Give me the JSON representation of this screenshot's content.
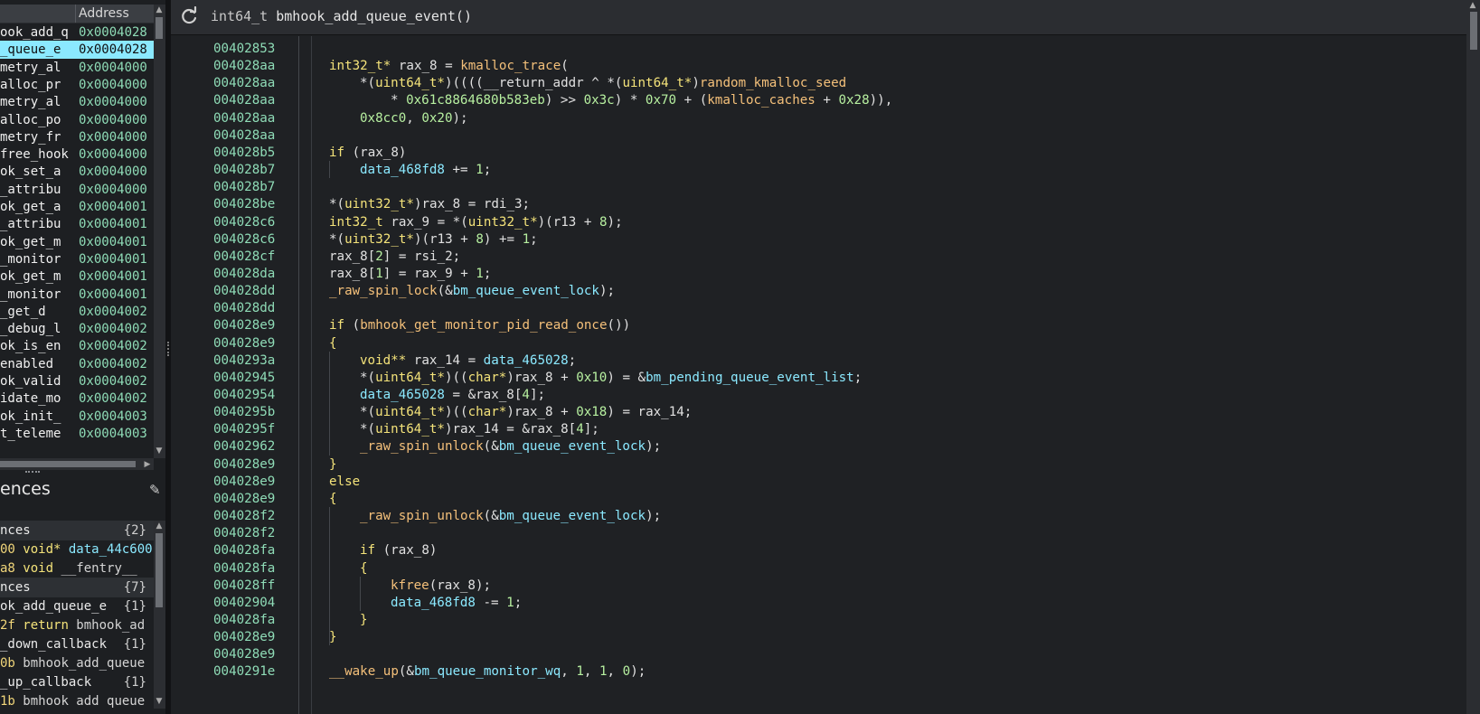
{
  "symbols": {
    "address_header": "Address",
    "rows": [
      {
        "name": "ook_add_q",
        "address": "0x0004028"
      },
      {
        "name": "_queue_e",
        "address": "0x0004028",
        "selected": true
      },
      {
        "name": "metry_al",
        "address": "0x0004000"
      },
      {
        "name": "alloc_pr",
        "address": "0x0004000"
      },
      {
        "name": "metry_al",
        "address": "0x0004000"
      },
      {
        "name": "alloc_po",
        "address": "0x0004000"
      },
      {
        "name": "metry_fr",
        "address": "0x0004000"
      },
      {
        "name": "free_hook",
        "address": "0x0004000"
      },
      {
        "name": "ok_set_a",
        "address": "0x0004000"
      },
      {
        "name": "_attribu",
        "address": "0x0004000"
      },
      {
        "name": "ok_get_a",
        "address": "0x0004001"
      },
      {
        "name": "_attribu",
        "address": "0x0004001"
      },
      {
        "name": "ok_get_m",
        "address": "0x0004001"
      },
      {
        "name": "_monitor",
        "address": "0x0004001"
      },
      {
        "name": "ok_get_m",
        "address": "0x0004001"
      },
      {
        "name": "_monitor",
        "address": "0x0004001"
      },
      {
        "name": "_get_d",
        "address": "0x0004002"
      },
      {
        "name": "_debug_l",
        "address": "0x0004002"
      },
      {
        "name": "ok_is_en",
        "address": "0x0004002"
      },
      {
        "name": "enabled",
        "address": "0x0004002"
      },
      {
        "name": "ok_valid",
        "address": "0x0004002"
      },
      {
        "name": "idate_mo",
        "address": "0x0004002"
      },
      {
        "name": "ok_init_",
        "address": "0x0004003"
      },
      {
        "name": "t_teleme",
        "address": "0x0004003"
      }
    ]
  },
  "references": {
    "title": "ences",
    "rows": [
      {
        "kind": "group",
        "text": "nces",
        "count": "{2}"
      },
      {
        "kind": "item",
        "addr": "00",
        "kw": "void*",
        "rest": " data_44c600"
      },
      {
        "kind": "item",
        "addr": "a8",
        "kw": "void",
        "rest": " __fentry__"
      },
      {
        "kind": "group",
        "text": "nces",
        "count": "{7}"
      },
      {
        "kind": "item",
        "text": "ok_add_queue_e",
        "count": "{1}"
      },
      {
        "kind": "item",
        "addr": "2f",
        "kw": "return",
        "rest": " bmhook_ad"
      },
      {
        "kind": "item",
        "text": "_down_callback",
        "count": "{1}"
      },
      {
        "kind": "item",
        "addr": "0b",
        "kw": "",
        "rest": "bmhook_add_queue"
      },
      {
        "kind": "item",
        "text": "_up_callback",
        "count": "{1}"
      },
      {
        "kind": "item",
        "addr": "1b",
        "kw": "",
        "rest": "bmhook_add_queue"
      }
    ]
  },
  "header": {
    "return_type": "int64_t",
    "function_name": "bmhook_add_queue_event()"
  },
  "code_lines": [
    {
      "addr": "00402853",
      "indent": 0,
      "tokens": []
    },
    {
      "addr": "004028aa",
      "indent": 1,
      "tokens": [
        [
          "type",
          "int32_t*"
        ],
        [
          "txt",
          " rax_8 = "
        ],
        [
          "fn",
          "kmalloc_trace"
        ],
        [
          "txt",
          "("
        ]
      ]
    },
    {
      "addr": "004028aa",
      "indent": 2,
      "tokens": [
        [
          "txt",
          "*("
        ],
        [
          "type",
          "uint64_t*"
        ],
        [
          "txt",
          ")(((("
        ],
        [
          "txt",
          "__return_addr ^ *("
        ],
        [
          "type",
          "uint64_t*"
        ],
        [
          "txt",
          ")"
        ],
        [
          "fn",
          "random_kmalloc_seed"
        ],
        [
          "txt",
          ""
        ]
      ]
    },
    {
      "addr": "004028aa",
      "indent": 3,
      "tokens": [
        [
          "txt",
          "* "
        ],
        [
          "num",
          "0x61c8864680b583eb"
        ],
        [
          "txt",
          ") >> "
        ],
        [
          "num",
          "0x3c"
        ],
        [
          "txt",
          ") * "
        ],
        [
          "num",
          "0x70"
        ],
        [
          "txt",
          " + ("
        ],
        [
          "fn",
          "kmalloc_caches"
        ],
        [
          "txt",
          " + "
        ],
        [
          "num",
          "0x28"
        ],
        [
          "txt",
          ")),"
        ]
      ]
    },
    {
      "addr": "004028aa",
      "indent": 2,
      "tokens": [
        [
          "num",
          "0x8cc0"
        ],
        [
          "txt",
          ", "
        ],
        [
          "num",
          "0x20"
        ],
        [
          "txt",
          ");"
        ]
      ]
    },
    {
      "addr": "004028aa",
      "indent": 0,
      "tokens": []
    },
    {
      "addr": "004028b5",
      "indent": 1,
      "tokens": [
        [
          "type",
          "if"
        ],
        [
          "txt",
          " (rax_8)"
        ]
      ]
    },
    {
      "addr": "004028b7",
      "indent": 2,
      "tokens": [
        [
          "data",
          "data_468fd8"
        ],
        [
          "txt",
          " += "
        ],
        [
          "num",
          "1"
        ],
        [
          "txt",
          ";"
        ]
      ]
    },
    {
      "addr": "004028b7",
      "indent": 0,
      "tokens": []
    },
    {
      "addr": "004028be",
      "indent": 1,
      "tokens": [
        [
          "txt",
          "*("
        ],
        [
          "type",
          "uint32_t*"
        ],
        [
          "txt",
          ")rax_8 = rdi_3;"
        ]
      ]
    },
    {
      "addr": "004028c6",
      "indent": 1,
      "tokens": [
        [
          "type",
          "int32_t"
        ],
        [
          "txt",
          " rax_9 = *("
        ],
        [
          "type",
          "uint32_t*"
        ],
        [
          "txt",
          ")(r13 + "
        ],
        [
          "num",
          "8"
        ],
        [
          "txt",
          ");"
        ]
      ]
    },
    {
      "addr": "004028c6",
      "indent": 1,
      "tokens": [
        [
          "txt",
          "*("
        ],
        [
          "type",
          "uint32_t*"
        ],
        [
          "txt",
          ")(r13 + "
        ],
        [
          "num",
          "8"
        ],
        [
          "txt",
          ") += "
        ],
        [
          "num",
          "1"
        ],
        [
          "txt",
          ";"
        ]
      ]
    },
    {
      "addr": "004028cf",
      "indent": 1,
      "tokens": [
        [
          "txt",
          "rax_8["
        ],
        [
          "num",
          "2"
        ],
        [
          "txt",
          "] = rsi_2;"
        ]
      ]
    },
    {
      "addr": "004028da",
      "indent": 1,
      "tokens": [
        [
          "txt",
          "rax_8["
        ],
        [
          "num",
          "1"
        ],
        [
          "txt",
          "] = rax_9 + "
        ],
        [
          "num",
          "1"
        ],
        [
          "txt",
          ";"
        ]
      ]
    },
    {
      "addr": "004028dd",
      "indent": 1,
      "tokens": [
        [
          "fn",
          "_raw_spin_lock"
        ],
        [
          "txt",
          "(&"
        ],
        [
          "data",
          "bm_queue_event_lock"
        ],
        [
          "txt",
          ");"
        ]
      ]
    },
    {
      "addr": "004028dd",
      "indent": 0,
      "tokens": []
    },
    {
      "addr": "004028e9",
      "indent": 1,
      "tokens": [
        [
          "type",
          "if"
        ],
        [
          "txt",
          " ("
        ],
        [
          "fn",
          "bmhook_get_monitor_pid_read_once"
        ],
        [
          "txt",
          "())"
        ]
      ]
    },
    {
      "addr": "004028e9",
      "indent": 1,
      "tokens": [
        [
          "type",
          "{"
        ]
      ]
    },
    {
      "addr": "0040293a",
      "indent": 2,
      "tokens": [
        [
          "type",
          "void**"
        ],
        [
          "txt",
          " rax_14 = "
        ],
        [
          "data",
          "data_465028"
        ],
        [
          "txt",
          ";"
        ]
      ]
    },
    {
      "addr": "00402945",
      "indent": 2,
      "tokens": [
        [
          "txt",
          "*("
        ],
        [
          "type",
          "uint64_t*"
        ],
        [
          "txt",
          ")(("
        ],
        [
          "type",
          "char*"
        ],
        [
          "txt",
          ")rax_8 + "
        ],
        [
          "num",
          "0x10"
        ],
        [
          "txt",
          ") = &"
        ],
        [
          "data",
          "bm_pending_queue_event_list"
        ],
        [
          "txt",
          ";"
        ]
      ]
    },
    {
      "addr": "00402954",
      "indent": 2,
      "tokens": [
        [
          "data",
          "data_465028"
        ],
        [
          "txt",
          " = &rax_8["
        ],
        [
          "num",
          "4"
        ],
        [
          "txt",
          "];"
        ]
      ]
    },
    {
      "addr": "0040295b",
      "indent": 2,
      "tokens": [
        [
          "txt",
          "*("
        ],
        [
          "type",
          "uint64_t*"
        ],
        [
          "txt",
          ")(("
        ],
        [
          "type",
          "char*"
        ],
        [
          "txt",
          ")rax_8 + "
        ],
        [
          "num",
          "0x18"
        ],
        [
          "txt",
          ") = rax_14;"
        ]
      ]
    },
    {
      "addr": "0040295f",
      "indent": 2,
      "tokens": [
        [
          "txt",
          "*("
        ],
        [
          "type",
          "uint64_t*"
        ],
        [
          "txt",
          ")rax_14 = &rax_8["
        ],
        [
          "num",
          "4"
        ],
        [
          "txt",
          "];"
        ]
      ]
    },
    {
      "addr": "00402962",
      "indent": 2,
      "tokens": [
        [
          "fn",
          "_raw_spin_unlock"
        ],
        [
          "txt",
          "(&"
        ],
        [
          "data",
          "bm_queue_event_lock"
        ],
        [
          "txt",
          ");"
        ]
      ]
    },
    {
      "addr": "004028e9",
      "indent": 1,
      "tokens": [
        [
          "type",
          "}"
        ]
      ]
    },
    {
      "addr": "004028e9",
      "indent": 1,
      "tokens": [
        [
          "type",
          "else"
        ]
      ]
    },
    {
      "addr": "004028e9",
      "indent": 1,
      "tokens": [
        [
          "type",
          "{"
        ]
      ]
    },
    {
      "addr": "004028f2",
      "indent": 2,
      "tokens": [
        [
          "fn",
          "_raw_spin_unlock"
        ],
        [
          "txt",
          "(&"
        ],
        [
          "data",
          "bm_queue_event_lock"
        ],
        [
          "txt",
          ");"
        ]
      ]
    },
    {
      "addr": "004028f2",
      "indent": 0,
      "tokens": []
    },
    {
      "addr": "004028fa",
      "indent": 2,
      "tokens": [
        [
          "type",
          "if"
        ],
        [
          "txt",
          " (rax_8)"
        ]
      ]
    },
    {
      "addr": "004028fa",
      "indent": 2,
      "tokens": [
        [
          "type",
          "{"
        ]
      ]
    },
    {
      "addr": "004028ff",
      "indent": 3,
      "tokens": [
        [
          "fn",
          "kfree"
        ],
        [
          "txt",
          "(rax_8);"
        ]
      ]
    },
    {
      "addr": "00402904",
      "indent": 3,
      "tokens": [
        [
          "data",
          "data_468fd8"
        ],
        [
          "txt",
          " -= "
        ],
        [
          "num",
          "1"
        ],
        [
          "txt",
          ";"
        ]
      ]
    },
    {
      "addr": "004028fa",
      "indent": 2,
      "tokens": [
        [
          "type",
          "}"
        ]
      ]
    },
    {
      "addr": "004028e9",
      "indent": 1,
      "tokens": [
        [
          "type",
          "}"
        ]
      ]
    },
    {
      "addr": "004028e9",
      "indent": 0,
      "tokens": []
    },
    {
      "addr": "0040291e",
      "indent": 1,
      "tokens": [
        [
          "fn",
          "__wake_up"
        ],
        [
          "txt",
          "(&"
        ],
        [
          "data",
          "bm_queue_monitor_wq"
        ],
        [
          "txt",
          ", "
        ],
        [
          "num",
          "1"
        ],
        [
          "txt",
          ", "
        ],
        [
          "num",
          "1"
        ],
        [
          "txt",
          ", "
        ],
        [
          "num",
          "0"
        ],
        [
          "txt",
          ");"
        ]
      ]
    }
  ]
}
